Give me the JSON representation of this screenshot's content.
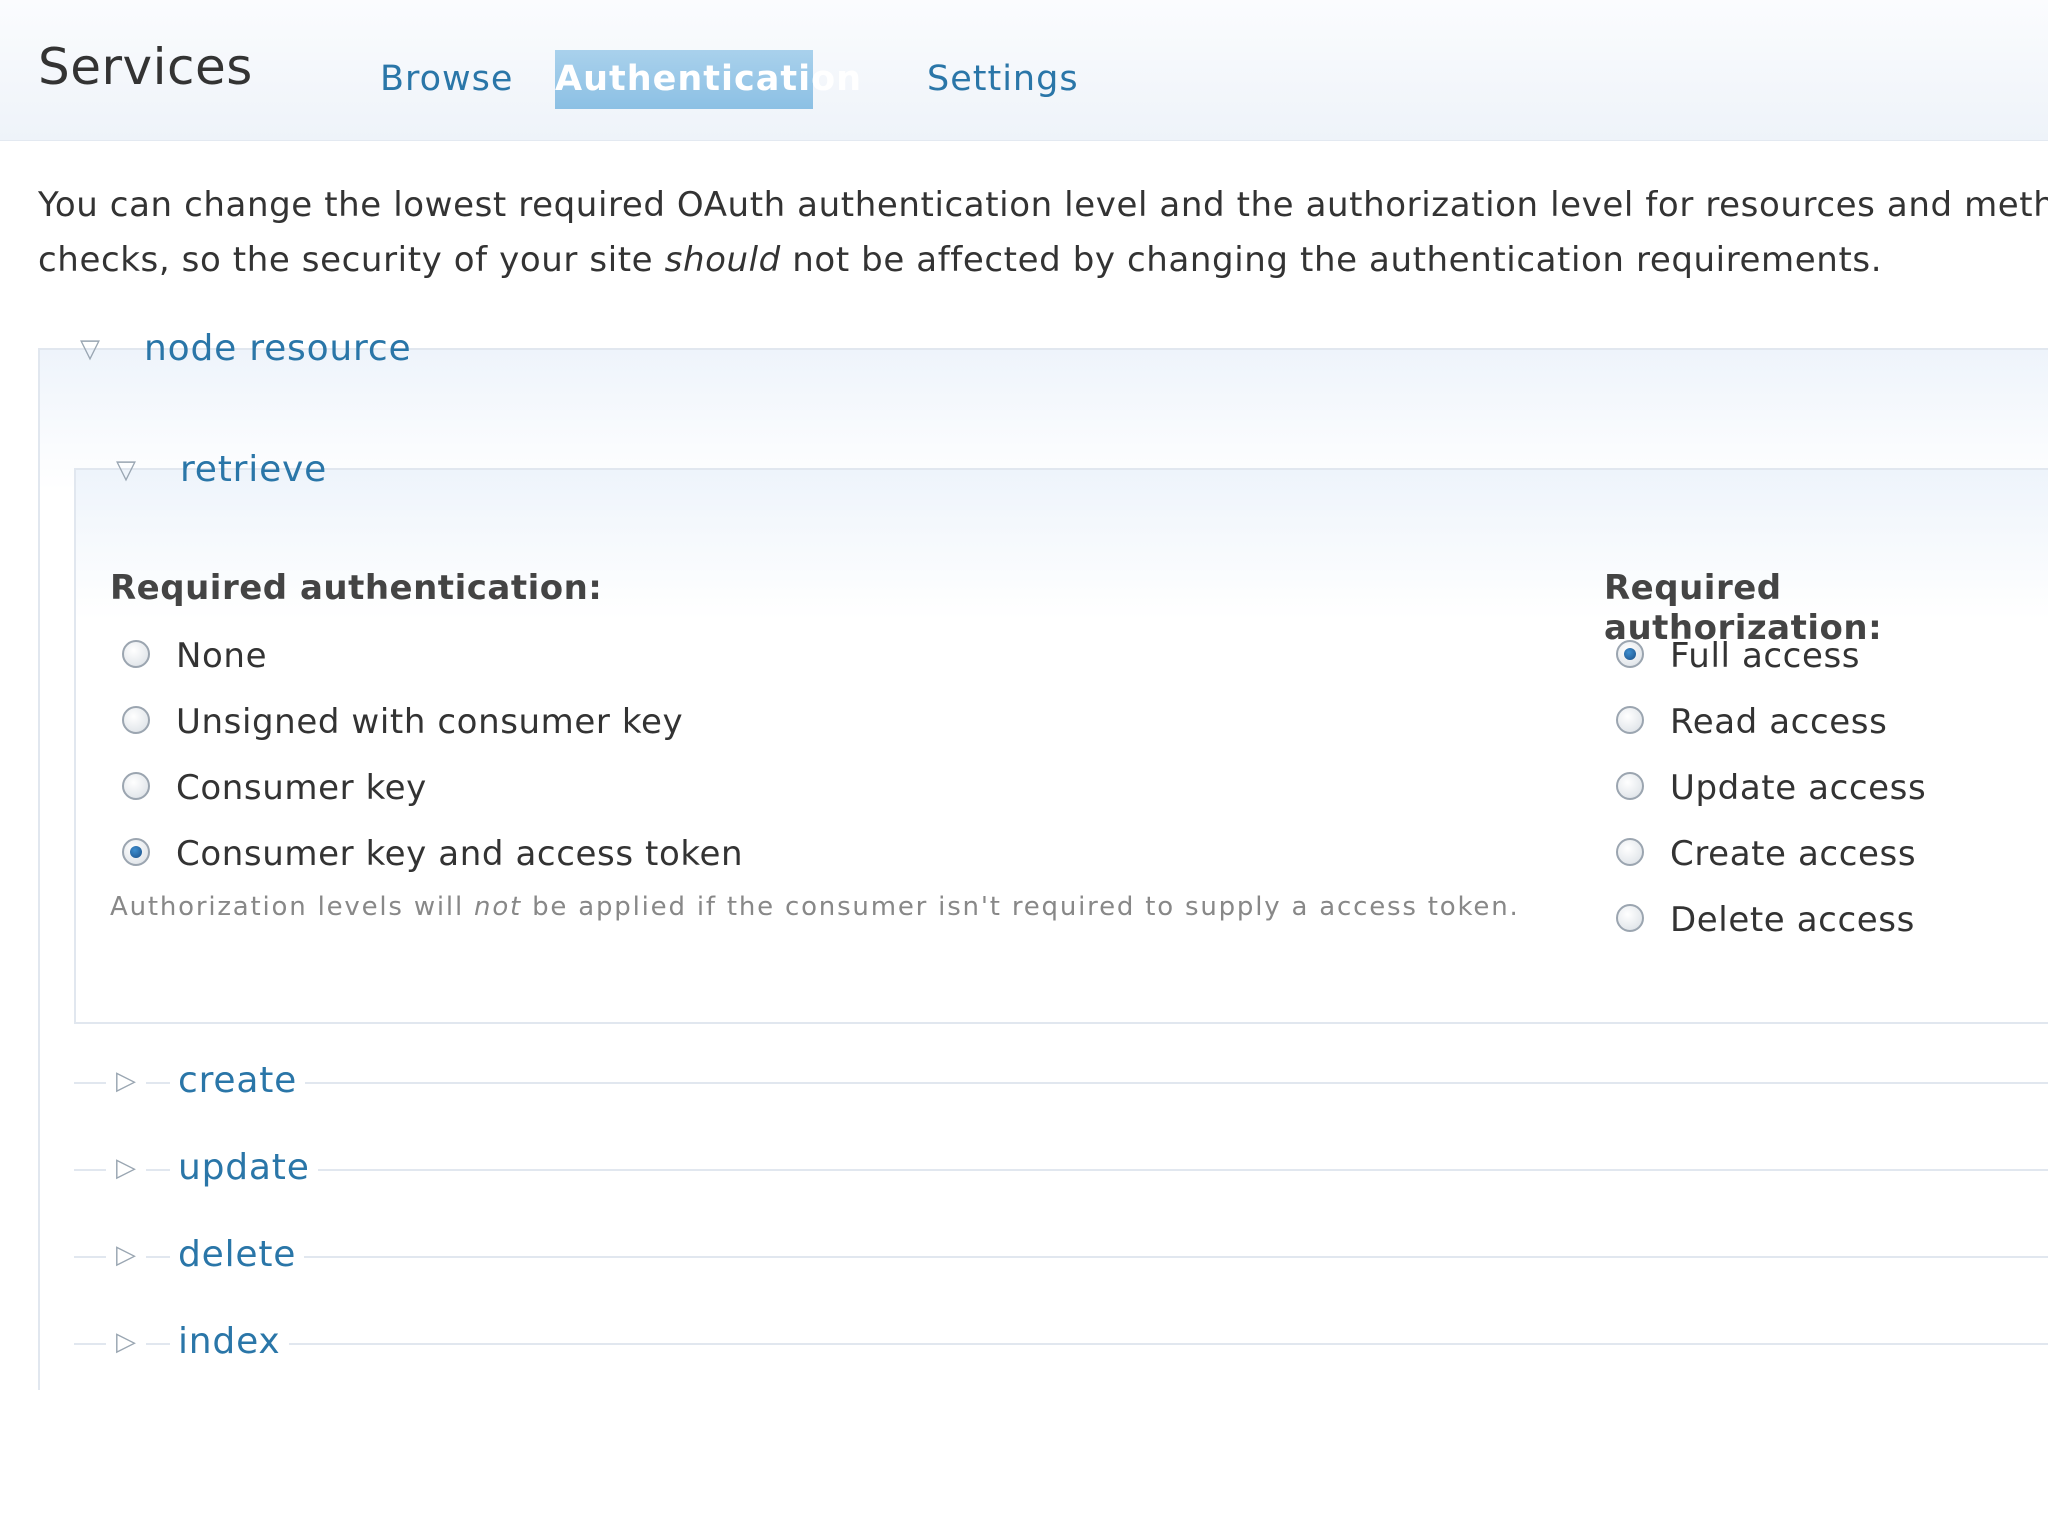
{
  "header": {
    "title": "Services",
    "tabs": [
      {
        "label": "Browse",
        "active": false
      },
      {
        "label": "Authentication",
        "active": true
      },
      {
        "label": "Settings",
        "active": false
      }
    ]
  },
  "intro": {
    "line1": "You can change the lowest required OAuth authentication level and the authorization level for resources and methoc",
    "line2_before": "checks, so the security of your site ",
    "line2_em": "should",
    "line2_after": " not be affected by changing the authentication requirements."
  },
  "resource": {
    "legend": "node resource",
    "method_open": {
      "legend": "retrieve",
      "authentication": {
        "heading": "Required authentication:",
        "options": [
          {
            "label": "None",
            "checked": false
          },
          {
            "label": "Unsigned with consumer key",
            "checked": false
          },
          {
            "label": "Consumer key",
            "checked": false
          },
          {
            "label": "Consumer key and access token",
            "checked": true
          }
        ],
        "help_before": "Authorization levels will ",
        "help_em": "not",
        "help_after": " be applied if the consumer isn't required to supply a access token."
      },
      "authorization": {
        "heading": "Required authorization:",
        "options": [
          {
            "label": "Full access",
            "checked": true
          },
          {
            "label": "Read access",
            "checked": false
          },
          {
            "label": "Update access",
            "checked": false
          },
          {
            "label": "Create access",
            "checked": false
          },
          {
            "label": "Delete access",
            "checked": false
          }
        ]
      }
    },
    "methods_collapsed": [
      "create",
      "update",
      "delete",
      "index"
    ]
  },
  "icons": {
    "expanded": "triangle-down-icon",
    "collapsed": "triangle-right-icon"
  },
  "colors": {
    "link": "#2a76a8",
    "active_tab": "#8cc0e4",
    "radio_checked": "#1b4f87"
  }
}
